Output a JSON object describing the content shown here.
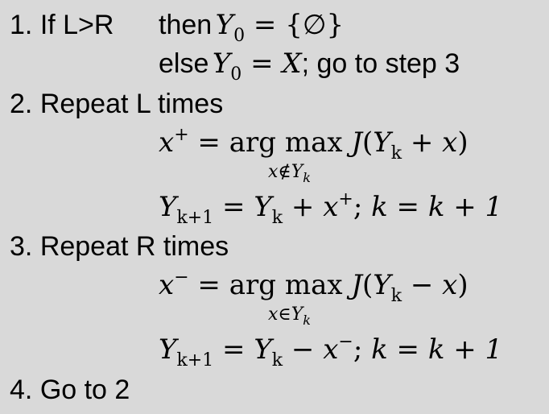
{
  "steps": [
    {
      "number": "1.",
      "label": "If L>R",
      "then_word": "then",
      "else_text": "else",
      "else_tail": "; go to step 3"
    },
    {
      "number": "2.",
      "label": "Repeat L times"
    },
    {
      "number": "3.",
      "label": "Repeat R times"
    },
    {
      "number": "4.",
      "label": "Go to 2"
    }
  ],
  "math": {
    "y0_sub": "0",
    "empty_set": "{∅}",
    "x_var": "X",
    "argmax": "arg max",
    "cond_not_in": "x∉Y",
    "cond_in": "x∈Y",
    "cond_sub": "k",
    "sup_plus": "+",
    "sup_minus": "−",
    "k_sub": "k",
    "k1_sub": "k+1",
    "k_update": "k = k + 1"
  }
}
